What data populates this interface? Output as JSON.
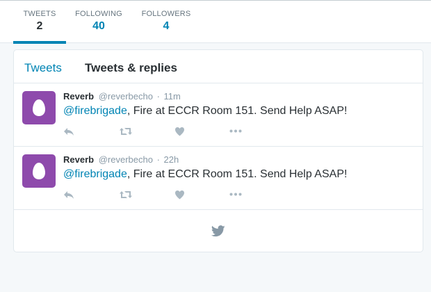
{
  "profile_nav": {
    "stats": [
      {
        "label": "TWEETS",
        "value": "2",
        "active": true
      },
      {
        "label": "FOLLOWING",
        "value": "40",
        "active": false
      },
      {
        "label": "FOLLOWERS",
        "value": "4",
        "active": false
      }
    ]
  },
  "timeline": {
    "tabs": [
      {
        "label": "Tweets",
        "active": false
      },
      {
        "label": "Tweets & replies",
        "active": true
      }
    ],
    "tweets": [
      {
        "fullname": "Reverb",
        "username": "@reverbecho",
        "separator": "·",
        "time": "11m",
        "mention": "@firebrigade",
        "text": ", Fire at ECCR Room 151. Send Help ASAP!"
      },
      {
        "fullname": "Reverb",
        "username": "@reverbecho",
        "separator": "·",
        "time": "22h",
        "mention": "@firebrigade",
        "text": ", Fire at ECCR Room 151. Send Help ASAP!"
      }
    ],
    "end_icon": "twitter-bird-icon"
  },
  "colors": {
    "accent": "#0084b4",
    "avatar_bg": "#8e4aac",
    "page_bg": "#f5f8fa",
    "icon_gray": "#aab8c2"
  },
  "icons": [
    "reply-icon",
    "retweet-icon",
    "heart-icon",
    "more-icon",
    "egg-avatar-icon",
    "twitter-bird-icon"
  ]
}
